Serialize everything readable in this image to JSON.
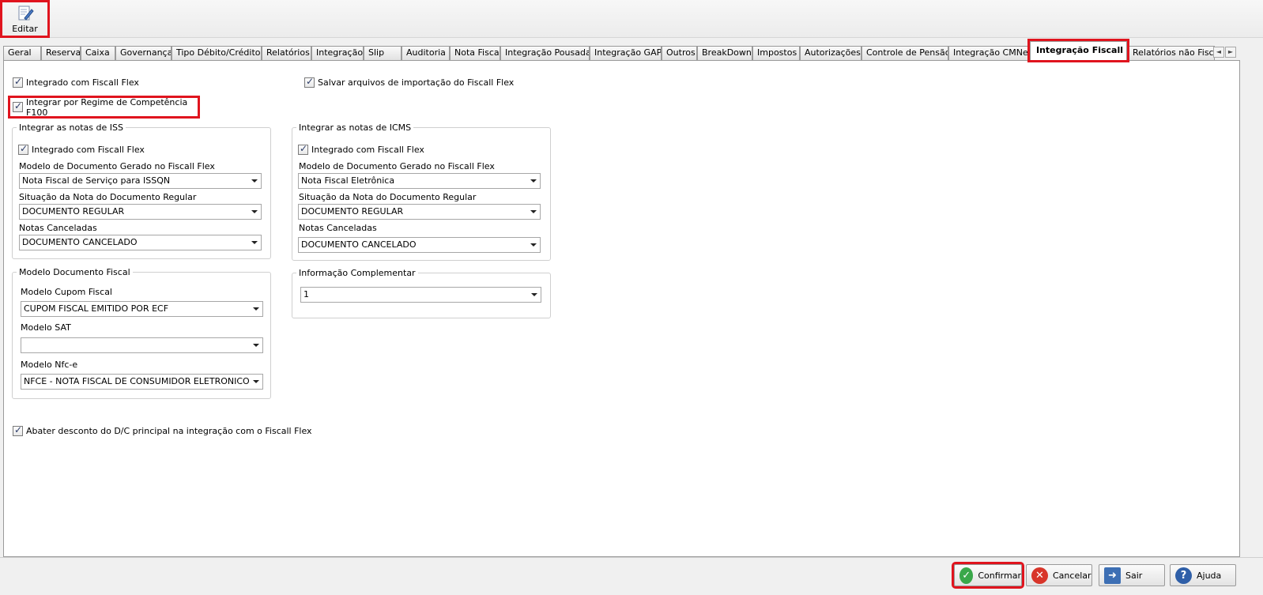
{
  "toolbar": {
    "editar_label": "Editar"
  },
  "tabs": [
    {
      "label": "Geral",
      "active": false
    },
    {
      "label": "Reserva",
      "active": false
    },
    {
      "label": "Caixa",
      "active": false
    },
    {
      "label": "Governança",
      "active": false
    },
    {
      "label": "Tipo Débito/Crédito",
      "active": false
    },
    {
      "label": "Relatórios",
      "active": false
    },
    {
      "label": "Integração",
      "active": false
    },
    {
      "label": "Slip",
      "active": false
    },
    {
      "label": "Auditoria",
      "active": false
    },
    {
      "label": "Nota Fiscal",
      "active": false
    },
    {
      "label": "Integração Pousada",
      "active": false
    },
    {
      "label": "Integração GAP",
      "active": false
    },
    {
      "label": "Outros",
      "active": false
    },
    {
      "label": "BreakDown",
      "active": false
    },
    {
      "label": "Impostos",
      "active": false
    },
    {
      "label": "Autorizações",
      "active": false
    },
    {
      "label": "Controle de Pensão",
      "active": false
    },
    {
      "label": "Integração CMNet",
      "active": false
    },
    {
      "label": "Integração Fiscall Flex",
      "active": true
    },
    {
      "label": "Relatórios não Fisca",
      "active": false
    }
  ],
  "tab_nav": {
    "left": "◄",
    "right": "►"
  },
  "options": {
    "integrado_fiscall_flex": "Integrado com Fiscall Flex",
    "salvar_arquivos": "Salvar arquivos de importação do Fiscall Flex",
    "integrar_regime": "Integrar por Regime de Competência F100",
    "abater_desconto": "Abater desconto do D/C principal na integração com o Fiscall Flex"
  },
  "iss": {
    "legend": "Integrar as notas de ISS",
    "integrado": "Integrado com Fiscall Flex",
    "modelo_label": "Modelo de Documento Gerado no Fiscall Flex",
    "modelo_value": "Nota Fiscal de Serviço para ISSQN",
    "situacao_label": "Situação da Nota do Documento Regular",
    "situacao_value": "DOCUMENTO REGULAR",
    "canceladas_label": "Notas Canceladas",
    "canceladas_value": "DOCUMENTO CANCELADO"
  },
  "icms": {
    "legend": "Integrar as notas de ICMS",
    "integrado": "Integrado com Fiscall Flex",
    "modelo_label": "Modelo de Documento Gerado no Fiscall Flex",
    "modelo_value": "Nota Fiscal Eletrônica",
    "situacao_label": "Situação da Nota do Documento Regular",
    "situacao_value": "DOCUMENTO REGULAR",
    "canceladas_label": "Notas Canceladas",
    "canceladas_value": "DOCUMENTO CANCELADO"
  },
  "modelo_doc": {
    "legend": "Modelo Documento Fiscal",
    "cupom_label": "Modelo Cupom Fiscal",
    "cupom_value": "CUPOM FISCAL EMITIDO POR ECF",
    "sat_label": "Modelo SAT",
    "sat_value": "",
    "nfce_label": "Modelo Nfc-e",
    "nfce_value": "NFCE - NOTA FISCAL DE CONSUMIDOR ELETRONICO"
  },
  "info_comp": {
    "legend": "Informação Complementar",
    "value": "1"
  },
  "buttons": {
    "confirmar": "Confirmar",
    "cancelar": "Cancelar",
    "sair": "Sair",
    "ajuda": "Ajuda"
  }
}
